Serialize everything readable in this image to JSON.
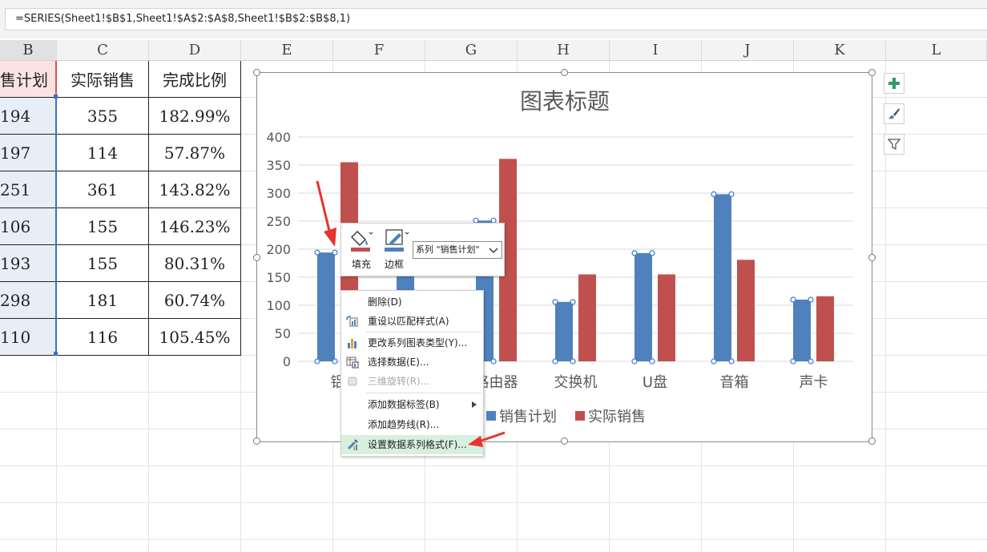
{
  "formula_bar": {
    "formula": "=SERIES(Sheet1!$B$1,Sheet1!$A$2:$A$8,Sheet1!$B$2:$B$8,1)"
  },
  "columns": [
    "B",
    "C",
    "D",
    "E",
    "F",
    "G",
    "H",
    "I",
    "J",
    "K",
    "L"
  ],
  "table": {
    "headers": [
      "售计划",
      "实际销售",
      "完成比例"
    ],
    "rows": [
      [
        "194",
        "355",
        "182.99%"
      ],
      [
        "197",
        "114",
        "57.87%"
      ],
      [
        "251",
        "361",
        "143.82%"
      ],
      [
        "106",
        "155",
        "146.23%"
      ],
      [
        "193",
        "155",
        "80.31%"
      ],
      [
        "298",
        "181",
        "60.74%"
      ],
      [
        "110",
        "116",
        "105.45%"
      ]
    ]
  },
  "chart_data": {
    "type": "bar",
    "title": "图表标题",
    "categories": [
      "铝",
      "",
      "路由器",
      "交换机",
      "U盘",
      "音箱",
      "声卡"
    ],
    "series": [
      {
        "name": "销售计划",
        "color": "#4f81bd",
        "values": [
          194,
          197,
          251,
          106,
          193,
          298,
          110
        ]
      },
      {
        "name": "实际销售",
        "color": "#c0504d",
        "values": [
          355,
          114,
          361,
          155,
          155,
          181,
          116
        ]
      }
    ],
    "ylim": [
      0,
      400
    ],
    "yticks": [
      "0",
      "50",
      "100",
      "150",
      "200",
      "250",
      "300",
      "350",
      "400"
    ],
    "grid": true,
    "legend_position": "bottom"
  },
  "mini_toolbar": {
    "fill_label": "填充",
    "border_label": "边框",
    "series_select": "系列 \"销售计划\""
  },
  "context_menu": {
    "items": [
      {
        "label": "删除(D)",
        "icon": "none",
        "disabled": false
      },
      {
        "label": "重设以匹配样式(A)",
        "icon": "reset-style-icon",
        "disabled": false
      },
      {
        "label": "更改系列图表类型(Y)...",
        "icon": "chart-type-icon",
        "disabled": false
      },
      {
        "label": "选择数据(E)...",
        "icon": "select-data-icon",
        "disabled": false
      },
      {
        "label": "三维旋转(R)...",
        "icon": "rotate-3d-icon",
        "disabled": true
      },
      {
        "label": "添加数据标签(B)",
        "icon": "none",
        "disabled": false
      },
      {
        "label": "添加趋势线(R)...",
        "icon": "none",
        "disabled": false
      },
      {
        "label": "设置数据系列格式(F)...",
        "icon": "format-series-icon",
        "disabled": false
      }
    ]
  },
  "colors": {
    "accent_green": "#2e9b5a",
    "arrow_red": "#e8332e",
    "menu_highlight": "#d7f0de"
  }
}
